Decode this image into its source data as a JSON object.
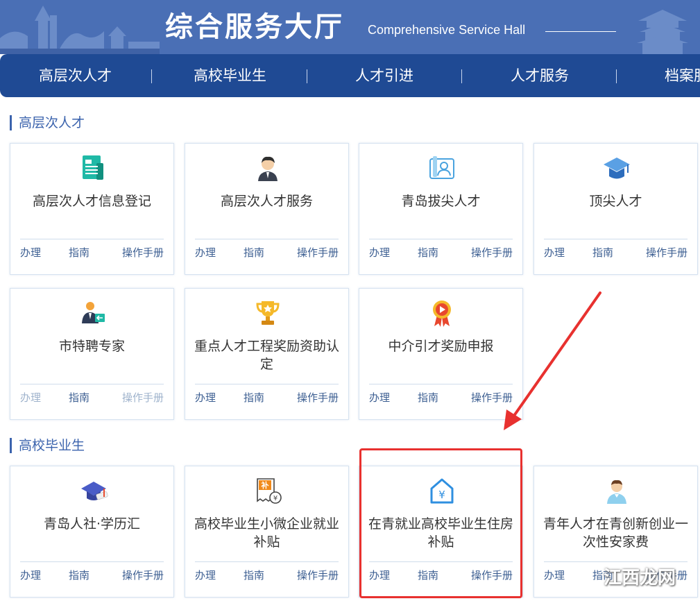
{
  "header": {
    "title": "综合服务大厅",
    "subtitle": "Comprehensive Service Hall"
  },
  "nav": {
    "items": [
      {
        "label": "高层次人才"
      },
      {
        "label": "高校毕业生"
      },
      {
        "label": "人才引进"
      },
      {
        "label": "人才服务"
      },
      {
        "label": "档案服务"
      }
    ]
  },
  "sections": [
    {
      "title": "高层次人才",
      "cards": [
        {
          "title": "高层次人才信息登记",
          "icon": "document-icon",
          "actions": [
            "办理",
            "指南",
            "操作手册"
          ],
          "disabled": []
        },
        {
          "title": "高层次人才服务",
          "icon": "person-icon",
          "actions": [
            "办理",
            "指南",
            "操作手册"
          ],
          "disabled": []
        },
        {
          "title": "青岛拔尖人才",
          "icon": "profile-map-icon",
          "actions": [
            "办理",
            "指南",
            "操作手册"
          ],
          "disabled": []
        },
        {
          "title": "顶尖人才",
          "icon": "graduation-cap-icon",
          "actions": [
            "办理",
            "指南",
            "操作手册"
          ],
          "disabled": []
        },
        {
          "title": "市特聘专家",
          "icon": "expert-icon",
          "actions": [
            "办理",
            "指南",
            "操作手册"
          ],
          "disabled": [
            "办理",
            "操作手册"
          ]
        },
        {
          "title": "重点人才工程奖励资助认定",
          "icon": "trophy-icon",
          "actions": [
            "办理",
            "指南",
            "操作手册"
          ],
          "disabled": []
        },
        {
          "title": "中介引才奖励申报",
          "icon": "medal-icon",
          "actions": [
            "办理",
            "指南",
            "操作手册"
          ],
          "disabled": []
        }
      ]
    },
    {
      "title": "高校毕业生",
      "cards": [
        {
          "title": "青岛人社·学历汇",
          "icon": "diploma-cap-icon",
          "actions": [
            "办理",
            "指南",
            "操作手册"
          ],
          "disabled": []
        },
        {
          "title": "高校毕业生小微企业就业补贴",
          "icon": "subsidy-icon",
          "actions": [
            "办理",
            "指南",
            "操作手册"
          ],
          "disabled": []
        },
        {
          "title": "在青就业高校毕业生住房补贴",
          "icon": "house-yuan-icon",
          "actions": [
            "办理",
            "指南",
            "操作手册"
          ],
          "disabled": []
        },
        {
          "title": "青年人才在青创新创业一次性安家费",
          "icon": "young-person-icon",
          "actions": [
            "办理",
            "指南",
            "操作手册"
          ],
          "disabled": []
        }
      ]
    }
  ],
  "watermark": "江西龙网",
  "colors": {
    "banner": "#4a6fb5",
    "nav": "#1f4a94",
    "accent": "#3b63ad",
    "highlight": "#e8312f"
  }
}
